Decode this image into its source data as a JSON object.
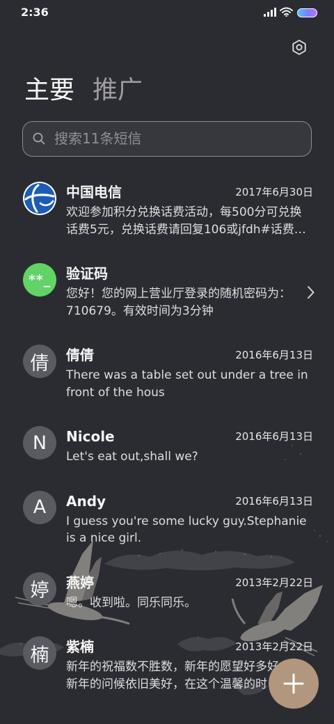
{
  "status_bar": {
    "time": "2:36",
    "icons": [
      "signal-icon",
      "wifi-icon",
      "battery-icon"
    ]
  },
  "header": {
    "settings_icon": "gear-icon",
    "tabs": [
      {
        "label": "主要",
        "active": true
      },
      {
        "label": "推广",
        "active": false
      }
    ]
  },
  "search": {
    "icon": "search-icon",
    "placeholder": "搜索11条短信"
  },
  "conversations": [
    {
      "name": "中国电信",
      "date": "2017年6月30日",
      "preview": [
        "欢迎参加积分兑换话费活动，每500分可兑换",
        "话费5元，兑换话费请回复106或jfdh#话费…"
      ],
      "avatar": {
        "type": "logo",
        "icon": "china-telecom-logo"
      }
    },
    {
      "name": "验证码",
      "preview": [
        "您好！您的网上营业厅登录的随机密码为：",
        "710679。有效时间为3分钟"
      ],
      "avatar": {
        "type": "text",
        "text": "**_",
        "color": "#62d367"
      },
      "chevron": "chevron-right-icon"
    },
    {
      "name": "倩倩",
      "date": "2016年6月13日",
      "preview": [
        "There was a table set out under a tree in",
        "front of the hous"
      ],
      "avatar": {
        "type": "text",
        "text": "倩",
        "color": "#5a5b61"
      }
    },
    {
      "name": "Nicole",
      "date": "2016年6月13日",
      "preview": [
        "Let's eat out,shall we?"
      ],
      "avatar": {
        "type": "text",
        "text": "N",
        "color": "#5a5b61"
      }
    },
    {
      "name": "Andy",
      "date": "2016年6月13日",
      "preview": [
        "I guess you're some lucky guy.Stephanie",
        "is a nice girl."
      ],
      "avatar": {
        "type": "text",
        "text": "A",
        "color": "#5a5b61"
      }
    },
    {
      "name": "燕婷",
      "date": "2013年2月22日",
      "preview": [
        "嗯。收到啦。同乐同乐。"
      ],
      "avatar": {
        "type": "text",
        "text": "婷",
        "color": "#5a5b61"
      }
    },
    {
      "name": "紫楠",
      "date": "2013年2月22日",
      "preview": [
        "新年的祝福数不胜数，新年的愿望好多好",
        "新年的问候依旧美好，在这个温馨的时"
      ],
      "avatar": {
        "type": "text",
        "text": "楠",
        "color": "#5a5b61"
      }
    }
  ],
  "fab": {
    "icon": "plus-icon",
    "color": "#b0977d"
  },
  "colors": {
    "background": "#2b2c31",
    "tab_active": "#f7f7f7",
    "tab_inactive": "#9c9ca1",
    "telecom_blue": "#1c5cb6"
  }
}
